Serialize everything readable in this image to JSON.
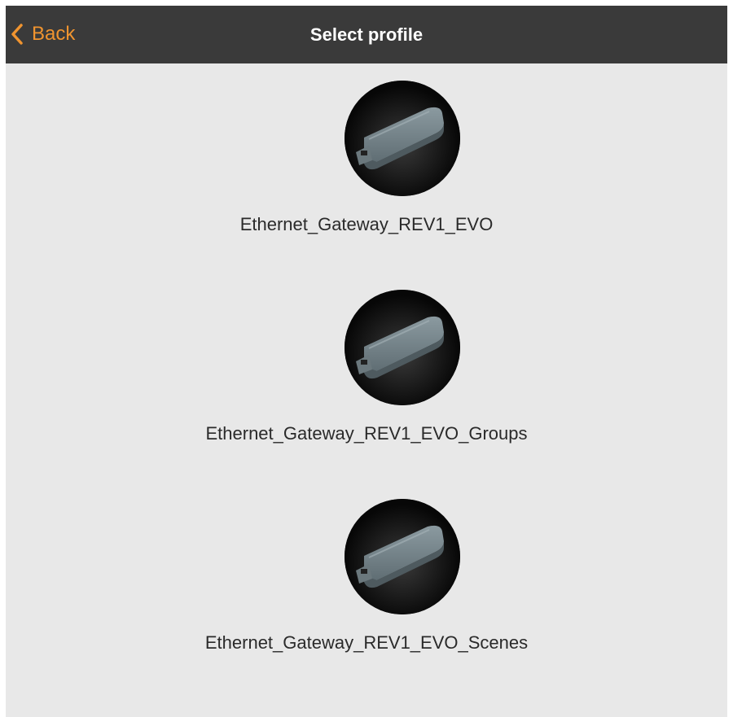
{
  "navbar": {
    "back_label": "Back",
    "title": "Select profile",
    "back_icon": "chevron-left-icon",
    "accent_color": "#f0942f",
    "background_color": "#3a3a3a"
  },
  "profiles": [
    {
      "label": "Ethernet_Gateway_REV1_EVO",
      "icon": "gateway-device-image"
    },
    {
      "label": "Ethernet_Gateway_REV1_EVO_Groups",
      "icon": "gateway-device-image"
    },
    {
      "label": "Ethernet_Gateway_REV1_EVO_Scenes",
      "icon": "gateway-device-image"
    }
  ]
}
